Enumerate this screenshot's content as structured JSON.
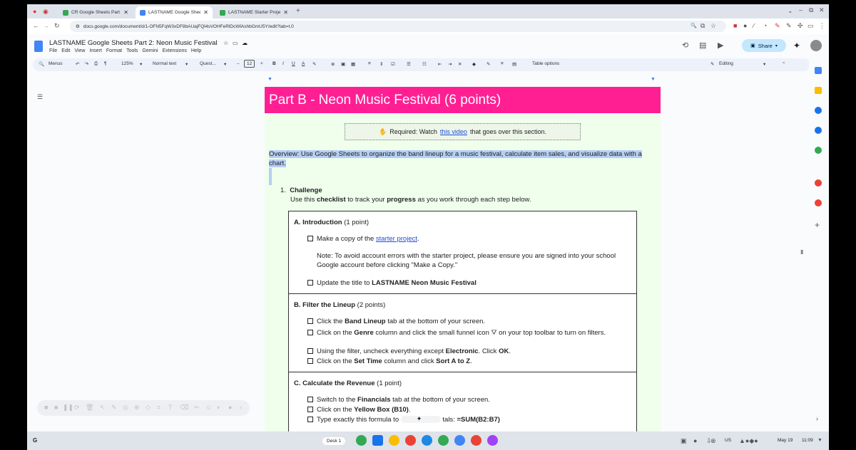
{
  "browser": {
    "tabs": [
      {
        "title": "CR Google Sheets Part 2: Neon",
        "color": "#34a853"
      },
      {
        "title": "LASTNAME Google Sheets Part",
        "color": "#4285f4"
      },
      {
        "title": "LASTNAME Starter Project - Ne",
        "color": "#34a853"
      }
    ],
    "url": "docs.google.com/document/d/1-OFN5FqW3xDF8bAUajFQl4sVOHFeRlDcWlAshbGmU5Y/edit?tab=t.0"
  },
  "doc": {
    "title": "LASTNAME Google Sheets Part 2: Neon Music Festival",
    "menus": [
      "File",
      "Edit",
      "View",
      "Insert",
      "Format",
      "Tools",
      "Gemini",
      "Extensions",
      "Help"
    ],
    "share_label": "Share"
  },
  "toolbar": {
    "menus_label": "Menus",
    "zoom": "125%",
    "style": "Normal text",
    "font": "Quest...",
    "font_size": "12",
    "table_options": "Table options",
    "mode": "Editing"
  },
  "page": {
    "banner": "Part B - Neon Music Festival (6 points)",
    "required": {
      "icon": "✋",
      "prefix": "Required: Watch",
      "link": "this video",
      "suffix": "that goes over this section."
    },
    "overview": "Overview: Use Google Sheets to organize the band lineup for a music festival, calculate item sales, and visualize data with a chart.",
    "challenge": {
      "number": "1.",
      "title": "Challenge",
      "desc_pre": "Use this",
      "desc_b1": "checklist",
      "desc_mid": "to track your",
      "desc_b2": "progress",
      "desc_post": "as you work through each step below."
    }
  },
  "checklist": {
    "A": {
      "title": "A. Introduction",
      "points": "(1 point)",
      "item1_pre": "Make a copy of the",
      "item1_link": "starter project",
      "item1_post": ".",
      "note": "Note: To avoid account errors with the starter project, please ensure you are signed into your school Google account before clicking \"Make a Copy.\"",
      "item2_pre": "Update the title to",
      "item2_b": "LASTNAME Neon Music Festival"
    },
    "B": {
      "title": "B. Filter the Lineup",
      "points": "(2 points)",
      "i1_pre": "Click the",
      "i1_b": "Band Lineup",
      "i1_post": "tab at the bottom of your screen.",
      "i2_pre": "Click on the",
      "i2_b": "Genre",
      "i2_post": "column and click the small funnel icon",
      "i2_icon": "⛛",
      "i2_post2": "on your top toolbar to turn on filters.",
      "i3_pre": "Using the filter, uncheck everything except",
      "i3_b": "Electronic",
      "i3_mid": ". Click",
      "i3_b2": "OK",
      "i3_post": ".",
      "i4_pre": "Click on the",
      "i4_b": "Set Time",
      "i4_mid": "column and click",
      "i4_b2": "Sort A to Z",
      "i4_post": "."
    },
    "C": {
      "title": "C. Calculate the Revenue",
      "points": "(1 point)",
      "i1_pre": "Switch to the",
      "i1_b": "Financials",
      "i1_post": "tab at the bottom of your screen.",
      "i2_pre": "Click on the",
      "i2_b": "Yellow Box (B10)",
      "i2_post": ".",
      "i3_pre": "Type exactly this formula to",
      "i3_mid": "tals:",
      "i3_b": "=SUM(B2:B7)"
    }
  },
  "taskbar": {
    "desk": "Desk 1",
    "locale": "US",
    "date": "May 19",
    "time": "11:09"
  }
}
